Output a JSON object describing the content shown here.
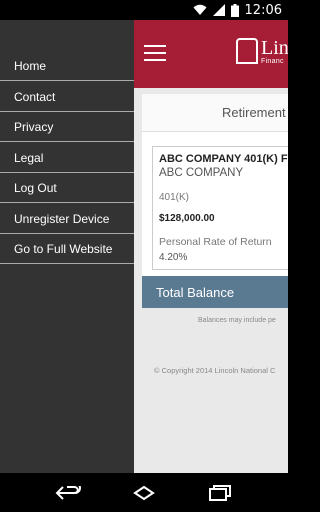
{
  "status_bar": {
    "time": "12:06",
    "icons": [
      "wifi-icon",
      "signal-icon",
      "battery-icon"
    ]
  },
  "drawer": {
    "items": [
      {
        "label": "Home"
      },
      {
        "label": "Contact"
      },
      {
        "label": "Privacy"
      },
      {
        "label": "Legal"
      },
      {
        "label": "Log Out"
      },
      {
        "label": "Unregister Device"
      },
      {
        "label": "Go to Full Website"
      }
    ]
  },
  "header": {
    "menu_icon": "hamburger-icon",
    "brand_name": "Lin",
    "brand_sub": "Financ",
    "brand_color": "#a51e36"
  },
  "panel": {
    "title": "Retirement A"
  },
  "account": {
    "name": "ABC COMPANY 401(K) F",
    "company": "ABC COMPANY",
    "type": "401(K)",
    "balance": "$128,000.00",
    "rate_label": "Personal Rate of Return",
    "rate_value": "4.20%"
  },
  "total": {
    "label": "Total Balance",
    "color": "#5a7a92"
  },
  "footer": {
    "note": "Balances may include pe",
    "copyright": "© Copyright 2014 Lincoln National C"
  },
  "nav_bar": {
    "icons": [
      "back-icon",
      "home-icon",
      "recent-apps-icon"
    ]
  }
}
